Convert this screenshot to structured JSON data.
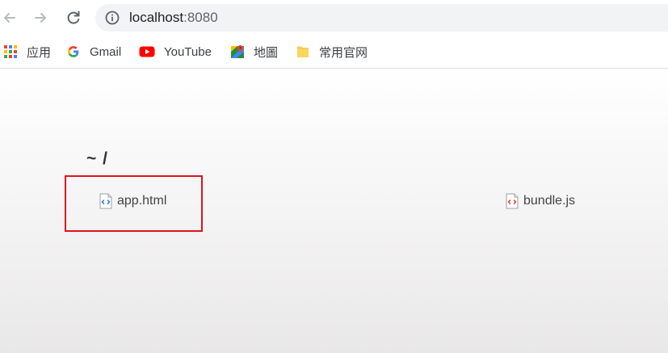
{
  "browser": {
    "address_bar": {
      "host": "localhost",
      "port": ":8080"
    },
    "nav_icons": [
      "back-arrow-icon",
      "forward-arrow-icon",
      "reload-icon",
      "info-icon"
    ]
  },
  "bookmarks": [
    {
      "label": "应用",
      "icon": "apps-grid-icon"
    },
    {
      "label": "Gmail",
      "icon": "google-g-icon"
    },
    {
      "label": "YouTube",
      "icon": "youtube-icon"
    },
    {
      "label": "地圖",
      "icon": "maps-icon"
    },
    {
      "label": "常用官网",
      "icon": "folder-icon"
    }
  ],
  "listing": {
    "title": "~ /",
    "files": [
      {
        "name": "app.html",
        "icon": "html-file-icon",
        "highlighted": true
      },
      {
        "name": "bundle.js",
        "icon": "js-file-icon",
        "highlighted": false
      }
    ]
  },
  "colors": {
    "highlight_border": "#e0131c",
    "html_icon_accent": "#3b86d6",
    "js_icon_accent": "#e34c4c",
    "omnibox_bg": "#f1f3f4"
  }
}
